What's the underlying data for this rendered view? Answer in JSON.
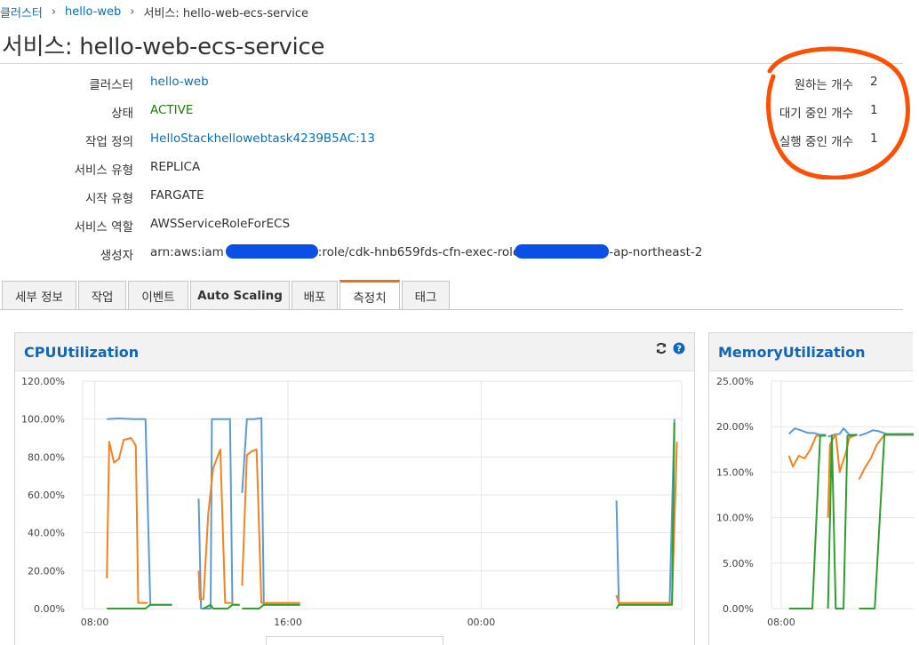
{
  "breadcrumb": {
    "items": [
      "클러스터",
      "hello-web",
      "서비스: hello-web-ecs-service"
    ]
  },
  "page": {
    "title": "서비스: hello-web-ecs-service"
  },
  "details": {
    "cluster": {
      "label": "클러스터",
      "value": "hello-web"
    },
    "status": {
      "label": "상태",
      "value": "ACTIVE"
    },
    "task_def": {
      "label": "작업 정의",
      "value": "HelloStackhellowebtask4239B5AC:13"
    },
    "service_type": {
      "label": "서비스 유형",
      "value": "REPLICA"
    },
    "launch_type": {
      "label": "시작 유형",
      "value": "FARGATE"
    },
    "service_role": {
      "label": "서비스 역할",
      "value": "AWSServiceRoleForECS"
    },
    "creator": {
      "label": "생성자",
      "part1": "arn:aws:iam",
      "part2": ":role/cdk-hnb659fds-cfn-exec-role",
      "part3": "-ap-northeast-2"
    }
  },
  "counts": {
    "desired": {
      "label": "원하는 개수",
      "value": "2"
    },
    "pending": {
      "label": "대기 중인 개수",
      "value": "1"
    },
    "running": {
      "label": "실행 중인 개수",
      "value": "1"
    }
  },
  "tabs": [
    {
      "label": "세부 정보"
    },
    {
      "label": "작업"
    },
    {
      "label": "이벤트"
    },
    {
      "label": "Auto Scaling"
    },
    {
      "label": "배포"
    },
    {
      "label": "측정치"
    },
    {
      "label": "태그"
    }
  ],
  "active_tab": "측정치",
  "icons": {
    "refresh": "refresh-icon",
    "help": "help-icon"
  },
  "colors": {
    "link": "#0073bb",
    "active_status": "#1d8102",
    "tab_accent": "#ec7211",
    "annotation": "#ff4f00",
    "series_blue": "#5b9bd5",
    "series_orange": "#f58220",
    "series_green": "#2ca02c"
  },
  "chart_data": [
    {
      "type": "line",
      "title": "CPUUtilization",
      "x_ticks": [
        "08:00",
        "16:00",
        "00:00"
      ],
      "y_ticks": [
        "0.00%",
        "20.00%",
        "40.00%",
        "60.00%",
        "80.00%",
        "100.00%",
        "120.00%"
      ],
      "ylim": [
        0,
        120
      ],
      "xlim": [
        7.5,
        32.3
      ],
      "series": [
        {
          "color": "#5b9bd5",
          "points": [
            [
              8.5,
              100
            ],
            [
              9.0,
              100.3
            ],
            [
              9.6,
              100
            ],
            [
              10.1,
              100
            ],
            [
              10.3,
              2
            ],
            [
              11.2,
              2
            ],
            [
              null,
              null
            ],
            [
              12.3,
              58
            ],
            [
              12.4,
              0
            ],
            [
              12.5,
              0
            ],
            [
              12.8,
              0
            ],
            [
              12.85,
              100
            ],
            [
              13.2,
              100
            ],
            [
              13.6,
              100
            ],
            [
              13.7,
              2
            ],
            [
              14.0,
              2
            ],
            [
              null,
              null
            ],
            [
              14.1,
              61
            ],
            [
              14.3,
              100
            ],
            [
              14.6,
              100
            ],
            [
              14.9,
              100.5
            ],
            [
              15.0,
              2
            ],
            [
              16.5,
              2
            ],
            [
              null,
              null
            ],
            [
              29.6,
              57
            ],
            [
              29.7,
              2
            ],
            [
              31.2,
              2
            ],
            [
              31.8,
              2
            ],
            [
              32.0,
              100
            ]
          ]
        },
        {
          "color": "#f58220",
          "points": [
            [
              8.5,
              16
            ],
            [
              8.6,
              88
            ],
            [
              8.8,
              77
            ],
            [
              9.0,
              79
            ],
            [
              9.2,
              89
            ],
            [
              9.5,
              90
            ],
            [
              9.7,
              86
            ],
            [
              9.8,
              3
            ],
            [
              10.2,
              3
            ],
            [
              null,
              null
            ],
            [
              12.3,
              20
            ],
            [
              12.35,
              5
            ],
            [
              12.5,
              5
            ],
            [
              12.7,
              50
            ],
            [
              12.9,
              74
            ],
            [
              13.2,
              84
            ],
            [
              13.4,
              3
            ],
            [
              13.7,
              3
            ],
            [
              null,
              null
            ],
            [
              14.1,
              12
            ],
            [
              14.3,
              81
            ],
            [
              14.5,
              83
            ],
            [
              14.7,
              84
            ],
            [
              14.9,
              3
            ],
            [
              16.5,
              3
            ],
            [
              null,
              null
            ],
            [
              29.6,
              7
            ],
            [
              29.7,
              3
            ],
            [
              31.9,
              3
            ],
            [
              32.1,
              88
            ]
          ]
        },
        {
          "color": "#2ca02c",
          "points": [
            [
              8.5,
              0
            ],
            [
              10.1,
              0
            ],
            [
              10.3,
              2
            ],
            [
              11.2,
              2
            ],
            [
              null,
              null
            ],
            [
              12.5,
              0
            ],
            [
              12.8,
              2
            ],
            [
              12.9,
              0
            ],
            [
              13.5,
              0
            ],
            [
              13.7,
              2
            ],
            [
              14.0,
              2
            ],
            [
              null,
              null
            ],
            [
              14.1,
              0
            ],
            [
              14.8,
              0
            ],
            [
              15.0,
              2
            ],
            [
              16.5,
              2
            ],
            [
              null,
              null
            ],
            [
              29.6,
              0
            ],
            [
              29.7,
              2
            ],
            [
              31.9,
              2
            ],
            [
              32.0,
              98
            ]
          ]
        }
      ]
    },
    {
      "type": "line",
      "title": "MemoryUtilization",
      "x_ticks": [
        "08:00"
      ],
      "y_ticks": [
        "0.00%",
        "5.00%",
        "10.00%",
        "15.00%",
        "20.00%",
        "25.00%"
      ],
      "ylim": [
        0,
        25
      ],
      "xlim": [
        7.5,
        14.8
      ],
      "series": [
        {
          "color": "#5b9bd5",
          "points": [
            [
              8.4,
              19.2
            ],
            [
              8.7,
              19.8
            ],
            [
              9.0,
              19.6
            ],
            [
              9.4,
              19.3
            ],
            [
              9.7,
              19.3
            ],
            [
              10.0,
              19.1
            ],
            [
              10.3,
              19.1
            ],
            [
              null,
              null
            ],
            [
              10.4,
              18.9
            ],
            [
              10.7,
              19.1
            ],
            [
              11.0,
              19.2
            ],
            [
              11.2,
              19.8
            ],
            [
              11.5,
              19.1
            ],
            [
              11.9,
              19.1
            ],
            [
              null,
              null
            ],
            [
              12.0,
              19.0
            ],
            [
              12.4,
              19.3
            ],
            [
              12.7,
              19.6
            ],
            [
              13.0,
              19.5
            ],
            [
              13.4,
              19.2
            ],
            [
              14.8,
              19.2
            ]
          ]
        },
        {
          "color": "#f58220",
          "points": [
            [
              8.4,
              16.8
            ],
            [
              8.6,
              15.6
            ],
            [
              8.9,
              16.8
            ],
            [
              9.2,
              16.5
            ],
            [
              9.5,
              17.5
            ],
            [
              9.8,
              19.0
            ],
            [
              10.3,
              19.0
            ],
            [
              null,
              null
            ],
            [
              10.4,
              10.0
            ],
            [
              10.5,
              18.0
            ],
            [
              10.8,
              19.2
            ],
            [
              11.0,
              15.0
            ],
            [
              11.3,
              17.0
            ],
            [
              11.5,
              18.8
            ],
            [
              11.9,
              19.1
            ],
            [
              null,
              null
            ],
            [
              12.0,
              14.2
            ],
            [
              12.3,
              15.5
            ],
            [
              12.6,
              16.5
            ],
            [
              12.9,
              18.0
            ],
            [
              13.3,
              19.1
            ],
            [
              14.8,
              19.1
            ]
          ]
        },
        {
          "color": "#2ca02c",
          "points": [
            [
              8.4,
              0
            ],
            [
              9.6,
              0
            ],
            [
              10.0,
              19.0
            ],
            [
              10.3,
              19.0
            ],
            [
              null,
              null
            ],
            [
              10.4,
              0
            ],
            [
              10.6,
              19.0
            ],
            [
              10.8,
              0
            ],
            [
              11.2,
              0
            ],
            [
              11.4,
              19.0
            ],
            [
              11.9,
              19.1
            ],
            [
              null,
              null
            ],
            [
              12.0,
              0
            ],
            [
              12.8,
              0
            ],
            [
              13.3,
              19.1
            ],
            [
              14.8,
              19.1
            ]
          ]
        }
      ]
    }
  ]
}
